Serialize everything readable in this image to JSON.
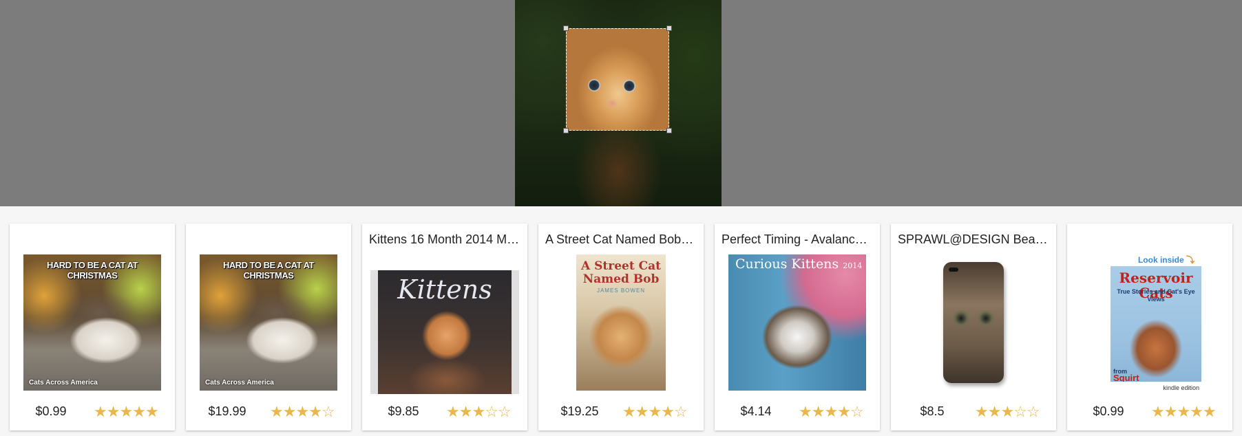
{
  "colors": {
    "top_bg": "#7c7c7c",
    "page_bg": "#f6f6f6",
    "star": "#e8b84a"
  },
  "query": {
    "icon": "crop-selection"
  },
  "results": [
    {
      "title": "",
      "price": "$0.99",
      "rating": 5,
      "image": {
        "caption": "HARD TO BE A CAT AT CHRISTMAS",
        "footer": "Cats Across America"
      }
    },
    {
      "title": "",
      "price": "$19.99",
      "rating": 4,
      "image": {
        "caption": "HARD TO BE A CAT AT CHRISTMAS",
        "footer": "Cats Across America"
      }
    },
    {
      "title": "Kittens 16 Month 2014 M…",
      "price": "$9.85",
      "rating": 3,
      "image": {
        "text": "Kittens"
      }
    },
    {
      "title": "A Street Cat Named Bob…",
      "price": "$19.25",
      "rating": 4,
      "image": {
        "text": "A Street Cat Named Bob",
        "author": "JAMES BOWEN"
      }
    },
    {
      "title": "Perfect Timing - Avalanc…",
      "price": "$4.14",
      "rating": 4,
      "image": {
        "text": "Curious Kittens",
        "year": "2014"
      }
    },
    {
      "title": "SPRAWL@DESIGN Bea…",
      "price": "$8.5",
      "rating": 3,
      "image": {}
    },
    {
      "title": "",
      "price": "$0.99",
      "rating": 5,
      "image": {
        "look": "Look",
        "inside": "inside",
        "text": "Reservoir Cats",
        "subtitle": "True Stories and Cat's Eye Views",
        "from": "from",
        "author": "Squirt",
        "badge": "kindle edition"
      }
    }
  ]
}
